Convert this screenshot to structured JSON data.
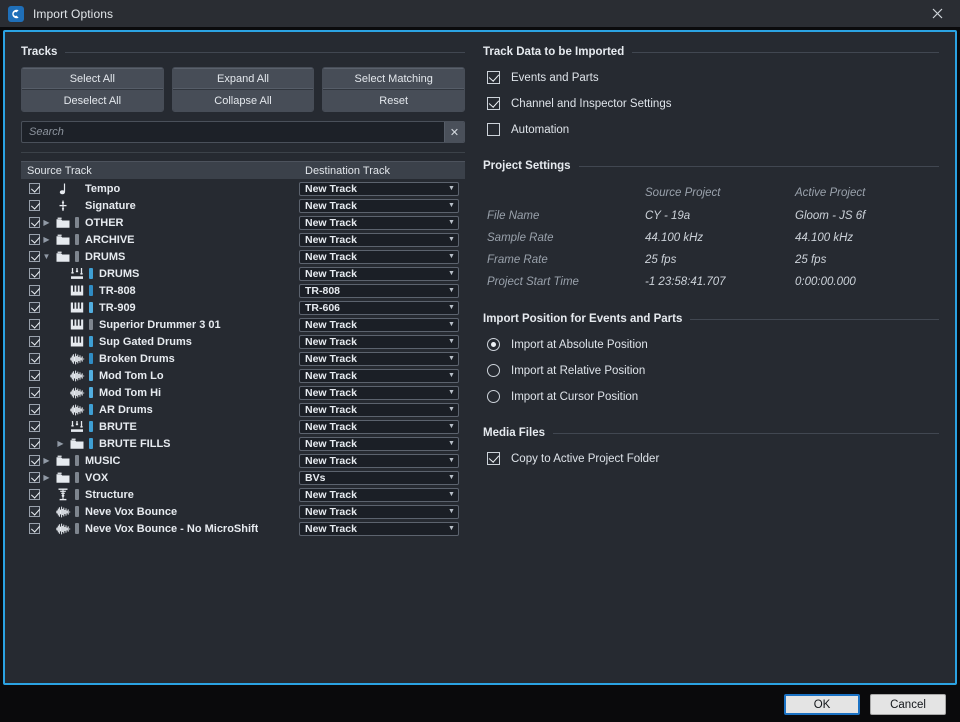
{
  "window": {
    "title": "Import Options",
    "app_icon": "cubase-logo-icon",
    "close_label": "✕"
  },
  "tracks_section": {
    "heading": "Tracks",
    "buttons": {
      "select_all": "Select All",
      "deselect_all": "Deselect All",
      "expand_all": "Expand All",
      "collapse_all": "Collapse All",
      "select_matching": "Select Matching",
      "reset": "Reset"
    },
    "search": {
      "value": "",
      "placeholder": "Search",
      "clear_label": "✕"
    },
    "table": {
      "columns": {
        "source": "Source Track",
        "destination": "Destination Track"
      },
      "rows": [
        {
          "checked": true,
          "depth": 0,
          "twisty": "none",
          "icon": "tempo-note-icon",
          "chip": "none",
          "name": "Tempo",
          "destination": "New Track"
        },
        {
          "checked": true,
          "depth": 0,
          "twisty": "none",
          "icon": "time-signature-icon",
          "chip": "none",
          "name": "Signature",
          "destination": "New Track"
        },
        {
          "checked": true,
          "depth": 0,
          "twisty": "collapsed",
          "icon": "folder-icon",
          "chip": "#7e858e",
          "name": "OTHER",
          "destination": "New Track"
        },
        {
          "checked": true,
          "depth": 0,
          "twisty": "collapsed",
          "icon": "folder-icon",
          "chip": "#7e858e",
          "name": "ARCHIVE",
          "destination": "New Track"
        },
        {
          "checked": true,
          "depth": 0,
          "twisty": "expanded",
          "icon": "folder-icon",
          "chip": "#7e858e",
          "name": "DRUMS",
          "destination": "New Track"
        },
        {
          "checked": true,
          "depth": 1,
          "twisty": "none",
          "icon": "instrument-icon",
          "chip": "#3e9fd4",
          "name": "DRUMS",
          "destination": "New Track"
        },
        {
          "checked": true,
          "depth": 1,
          "twisty": "none",
          "icon": "midi-keys-icon",
          "chip": "#2f8cc4",
          "name": "TR-808",
          "destination": "TR-808"
        },
        {
          "checked": true,
          "depth": 1,
          "twisty": "none",
          "icon": "midi-keys-icon",
          "chip": "#52aee0",
          "name": "TR-909",
          "destination": "TR-606"
        },
        {
          "checked": true,
          "depth": 1,
          "twisty": "none",
          "icon": "midi-keys-icon",
          "chip": "#7e858e",
          "name": "Superior Drummer 3 01",
          "destination": "New Track"
        },
        {
          "checked": true,
          "depth": 1,
          "twisty": "none",
          "icon": "midi-keys-icon",
          "chip": "#3e9fd4",
          "name": "Sup Gated Drums",
          "destination": "New Track"
        },
        {
          "checked": true,
          "depth": 1,
          "twisty": "none",
          "icon": "audio-wave-icon",
          "chip": "#2f8cc4",
          "name": "Broken Drums",
          "destination": "New Track"
        },
        {
          "checked": true,
          "depth": 1,
          "twisty": "none",
          "icon": "audio-wave-icon",
          "chip": "#52aee0",
          "name": "Mod Tom Lo",
          "destination": "New Track"
        },
        {
          "checked": true,
          "depth": 1,
          "twisty": "none",
          "icon": "audio-wave-icon",
          "chip": "#52aee0",
          "name": "Mod Tom Hi",
          "destination": "New Track"
        },
        {
          "checked": true,
          "depth": 1,
          "twisty": "none",
          "icon": "audio-wave-icon",
          "chip": "#3e9fd4",
          "name": "AR Drums",
          "destination": "New Track"
        },
        {
          "checked": true,
          "depth": 1,
          "twisty": "none",
          "icon": "instrument-icon",
          "chip": "#3e9fd4",
          "name": "BRUTE",
          "destination": "New Track"
        },
        {
          "checked": true,
          "depth": 1,
          "twisty": "collapsed",
          "icon": "folder-icon",
          "chip": "#3e9fd4",
          "name": "BRUTE FILLS",
          "destination": "New Track"
        },
        {
          "checked": true,
          "depth": 0,
          "twisty": "collapsed",
          "icon": "folder-icon",
          "chip": "#7e858e",
          "name": "MUSIC",
          "destination": "New Track"
        },
        {
          "checked": true,
          "depth": 0,
          "twisty": "collapsed",
          "icon": "folder-icon",
          "chip": "#7e858e",
          "name": "VOX",
          "destination": "BVs"
        },
        {
          "checked": true,
          "depth": 0,
          "twisty": "none",
          "icon": "vst-rack-icon",
          "chip": "#7e858e",
          "name": "Structure",
          "destination": "New Track"
        },
        {
          "checked": true,
          "depth": 0,
          "twisty": "none",
          "icon": "audio-wave-icon",
          "chip": "#7e858e",
          "name": "Neve Vox Bounce",
          "destination": "New Track"
        },
        {
          "checked": true,
          "depth": 0,
          "twisty": "none",
          "icon": "audio-wave-icon",
          "chip": "#7e858e",
          "name": "Neve Vox Bounce - No MicroShift",
          "destination": "New Track"
        }
      ]
    }
  },
  "track_data_section": {
    "heading": "Track Data to be Imported",
    "options": [
      {
        "label": "Events and Parts",
        "checked": true
      },
      {
        "label": "Channel and Inspector Settings",
        "checked": true
      },
      {
        "label": "Automation",
        "checked": false
      }
    ]
  },
  "project_settings": {
    "heading": "Project Settings",
    "col_source": "Source Project",
    "col_active": "Active Project",
    "rows": [
      {
        "label": "File Name",
        "source": "CY - 19a",
        "active": "Gloom - JS 6f"
      },
      {
        "label": "Sample Rate",
        "source": "44.100 kHz",
        "active": "44.100 kHz"
      },
      {
        "label": "Frame Rate",
        "source": "25 fps",
        "active": "25 fps"
      },
      {
        "label": "Project Start Time",
        "source": "-1 23:58:41.707",
        "active": "0:00:00.000"
      }
    ]
  },
  "import_position": {
    "heading": "Import Position for Events and Parts",
    "options": [
      {
        "label": "Import at Absolute Position",
        "selected": true
      },
      {
        "label": "Import at Relative Position",
        "selected": false
      },
      {
        "label": "Import at Cursor Position",
        "selected": false
      }
    ]
  },
  "media_files": {
    "heading": "Media Files",
    "options": [
      {
        "label": "Copy to Active Project Folder",
        "checked": true
      }
    ]
  },
  "footer": {
    "ok": "OK",
    "cancel": "Cancel"
  },
  "colors": {
    "accent_border": "#2ba3e3",
    "dialog_bg": "#262a31",
    "titlebar_bg": "#2a2d33",
    "footer_bg": "#0a0a0c"
  }
}
